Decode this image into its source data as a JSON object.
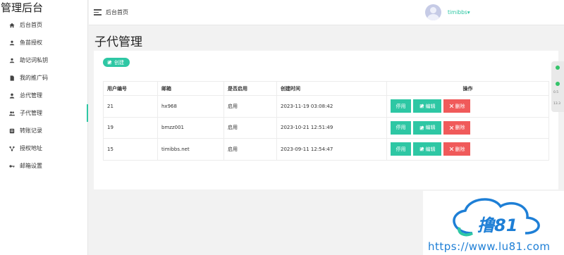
{
  "app": {
    "brand": "管理后台"
  },
  "sidebar": {
    "items": [
      {
        "label": "后台首页",
        "icon": "home-icon"
      },
      {
        "label": "鱼苗授权",
        "icon": "fish-icon"
      },
      {
        "label": "助记词私钥",
        "icon": "key-icon"
      },
      {
        "label": "我的推广码",
        "icon": "document-icon"
      },
      {
        "label": "总代管理",
        "icon": "user-icon"
      },
      {
        "label": "子代管理",
        "icon": "users-icon",
        "active": true
      },
      {
        "label": "转账记录",
        "icon": "list-icon"
      },
      {
        "label": "授权地址",
        "icon": "share-icon"
      },
      {
        "label": "邮箱设置",
        "icon": "key-icon"
      }
    ]
  },
  "header": {
    "breadcrumb": "后台首页",
    "username": "timibbs",
    "menu_icon": "hamburger-icon"
  },
  "page": {
    "title": "子代管理",
    "create_label": "创建"
  },
  "table": {
    "headers": [
      "用户编号",
      "邮箱",
      "是否启用",
      "创建时间",
      "操作"
    ],
    "rows": [
      {
        "id": "21",
        "email": "hx968",
        "enabled": "启用",
        "created": "2023-11-19 03:08:42"
      },
      {
        "id": "19",
        "email": "bmzz001",
        "enabled": "启用",
        "created": "2023-10-21 12:51:49"
      },
      {
        "id": "15",
        "email": "timibbs.net",
        "enabled": "启用",
        "created": "2023-09-11 12:54:47"
      }
    ],
    "actions": {
      "stop": "停用",
      "edit": "编辑",
      "delete": "删除"
    }
  },
  "widget": {
    "v1": "0.5",
    "v2": "13.3"
  },
  "watermark": {
    "logo_text": "撸81",
    "url": "https://www.lu81.com"
  },
  "colors": {
    "accent": "#2ec7a4",
    "danger": "#f05a5a",
    "watermark": "#1e7fd6"
  }
}
